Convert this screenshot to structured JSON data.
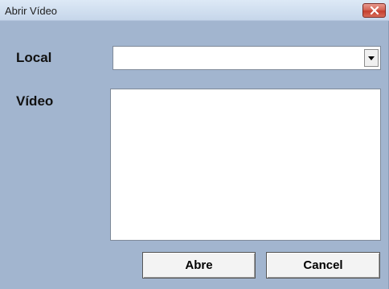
{
  "window": {
    "title": "Abrir Vídeo",
    "close_icon": "close-icon"
  },
  "form": {
    "local_label": "Local",
    "local_value": "",
    "video_label": "Vídeo",
    "video_items": []
  },
  "buttons": {
    "open_label": "Abre",
    "cancel_label": "Cancel"
  },
  "colors": {
    "dialog_background": "#a2b5cf",
    "close_button": "#c43f2e"
  }
}
